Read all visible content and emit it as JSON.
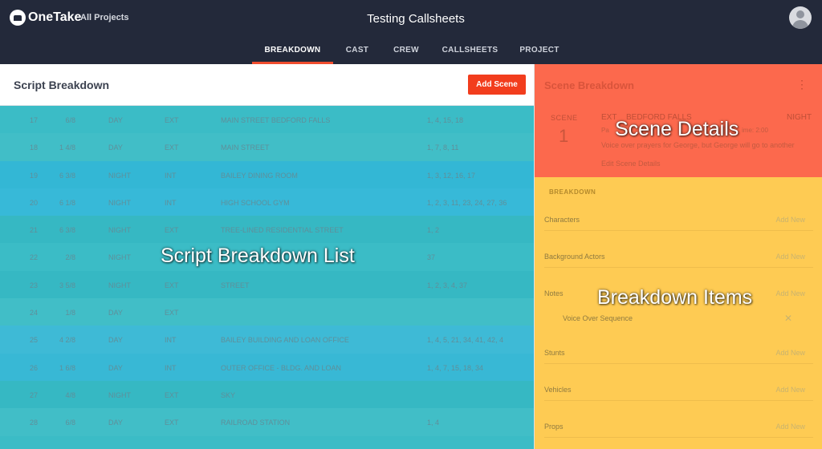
{
  "topbar": {
    "logo": "OneTake",
    "all_projects": "All Projects",
    "title": "Testing Callsheets"
  },
  "tabs": [
    {
      "label": "BREAKDOWN",
      "active": true
    },
    {
      "label": "CAST"
    },
    {
      "label": "CREW"
    },
    {
      "label": "CALLSHEETS"
    },
    {
      "label": "PROJECT"
    }
  ],
  "left": {
    "title": "Script Breakdown",
    "add_scene": "Add Scene",
    "overlay_label": "Script Breakdown List"
  },
  "rows": [
    {
      "num": "17",
      "pages": "6/8",
      "time": "DAY",
      "ie": "EXT",
      "location": "MAIN STREET BEDFORD FALLS",
      "cast": "1, 4, 15, 18",
      "color": "#3bbcc6"
    },
    {
      "num": "18",
      "pages": "1 4/8",
      "time": "DAY",
      "ie": "EXT",
      "location": "MAIN STREET",
      "cast": "1, 7, 8, 11",
      "color": "#41bec7"
    },
    {
      "num": "19",
      "pages": "6 3/8",
      "time": "NIGHT",
      "ie": "INT",
      "location": "BAILEY DINING ROOM",
      "cast": "1, 3, 12, 16, 17",
      "color": "#33b7d5"
    },
    {
      "num": "20",
      "pages": "6 1/8",
      "time": "NIGHT",
      "ie": "INT",
      "location": "HIGH SCHOOL GYM",
      "cast": "1, 2, 3, 11, 23, 24, 27, 36",
      "color": "#37b9d8"
    },
    {
      "num": "21",
      "pages": "6 3/8",
      "time": "NIGHT",
      "ie": "EXT",
      "location": "TREE-LINED RESIDENTIAL STREET",
      "cast": "1, 2",
      "color": "#36b8c3"
    },
    {
      "num": "22",
      "pages": "2/8",
      "time": "NIGHT",
      "ie": "",
      "location": "",
      "cast": "37",
      "color": "#3bbcc6"
    },
    {
      "num": "23",
      "pages": "3 5/8",
      "time": "NIGHT",
      "ie": "EXT",
      "location": "STREET",
      "cast": "1, 2, 3, 4, 37",
      "color": "#36b8c3"
    },
    {
      "num": "24",
      "pages": "1/8",
      "time": "DAY",
      "ie": "EXT",
      "location": "",
      "cast": "",
      "color": "#41bec7"
    },
    {
      "num": "25",
      "pages": "4 2/8",
      "time": "DAY",
      "ie": "INT",
      "location": "BAILEY BUILDING AND LOAN OFFICE",
      "cast": "1, 4, 5, 21, 34, 41, 42, 4",
      "color": "#3ebad6"
    },
    {
      "num": "26",
      "pages": "1 6/8",
      "time": "DAY",
      "ie": "INT",
      "location": "OUTER OFFICE - BLDG. AND LOAN",
      "cast": "1, 4, 7, 15, 18, 34",
      "color": "#38b8d5"
    },
    {
      "num": "27",
      "pages": "4/8",
      "time": "NIGHT",
      "ie": "EXT",
      "location": "SKY",
      "cast": "",
      "color": "#36b8c3"
    },
    {
      "num": "28",
      "pages": "6/8",
      "time": "DAY",
      "ie": "EXT",
      "location": "RAILROAD STATION",
      "cast": "1, 4",
      "color": "#41bec7"
    },
    {
      "num": "",
      "pages": "",
      "time": "",
      "ie": "",
      "location": "",
      "cast": "",
      "color": "#3bbcc6"
    }
  ],
  "scene": {
    "title": "Scene Breakdown",
    "more": "⋮",
    "scene_label": "SCENE",
    "scene_number": "1",
    "ie": "EXT",
    "location": "BEDFORD FALLS",
    "time": "NIGHT",
    "pages": "Pa",
    "runtime": "ime: 2:00",
    "description": "Voice over prayers for George, but George will go to another",
    "edit": "Edit Scene Details",
    "overlay_label": "Scene Details"
  },
  "breakdown": {
    "heading": "BREAKDOWN",
    "overlay_label": "Breakdown Items",
    "add_label": "Add New",
    "categories": [
      "Characters",
      "Background Actors",
      "Notes",
      "Stunts",
      "Vehicles",
      "Props"
    ],
    "note_item": "Voice Over Sequence",
    "remove": "✕"
  },
  "colors": {
    "topbar": "#23293a",
    "accent": "#f23d1d",
    "scene_highlight": "#fc694d",
    "breakdown_highlight": "#fecb53"
  }
}
